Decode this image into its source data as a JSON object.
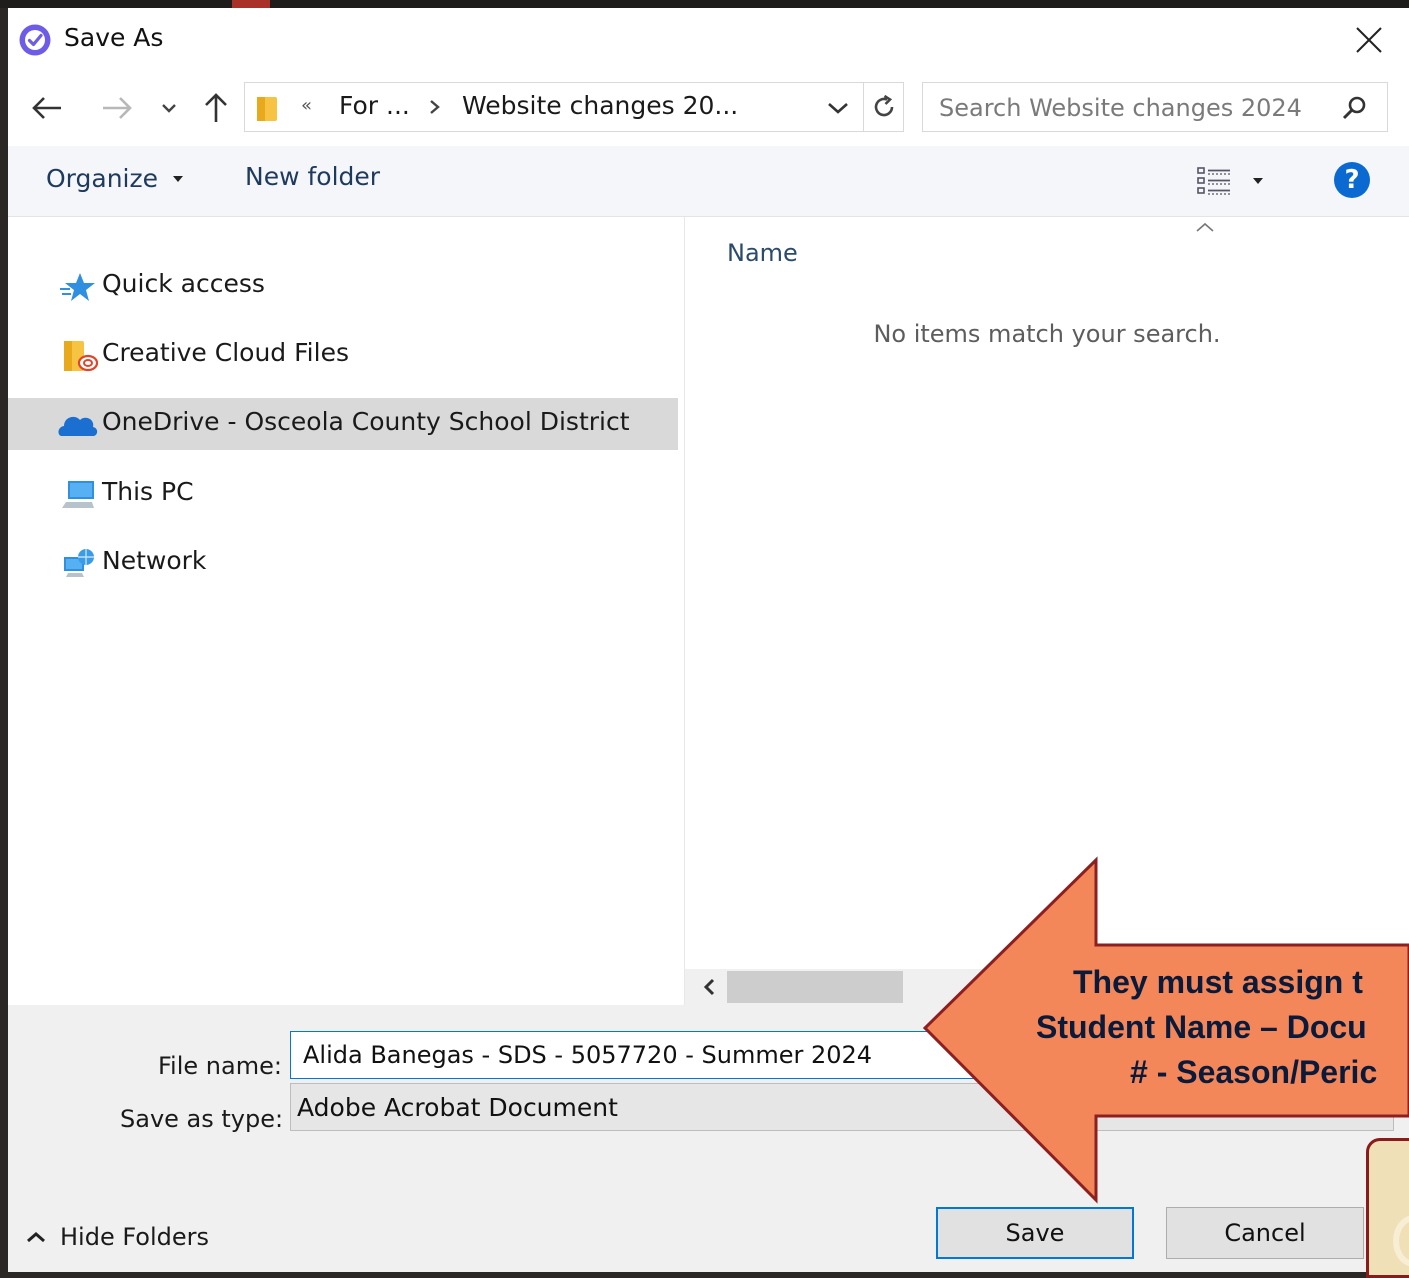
{
  "dialog": {
    "title": "Save As"
  },
  "address": {
    "overflow": "«",
    "crumbs": [
      "For ...",
      "Website changes 20..."
    ]
  },
  "search": {
    "placeholder": "Search Website changes 2024"
  },
  "toolbar": {
    "organize": "Organize",
    "new_folder": "New folder"
  },
  "nav": {
    "items": [
      {
        "label": "Quick access",
        "icon": "star-icon"
      },
      {
        "label": "Creative Cloud Files",
        "icon": "creative-cloud-folder-icon"
      },
      {
        "label": "OneDrive - Osceola County School District",
        "icon": "onedrive-cloud-icon",
        "selected": true
      },
      {
        "label": "This PC",
        "icon": "computer-icon"
      },
      {
        "label": "Network",
        "icon": "network-icon"
      }
    ]
  },
  "content": {
    "column_name": "Name",
    "empty_message": "No items match your search."
  },
  "form": {
    "filename_label": "File name:",
    "filename_value": "Alida Banegas - SDS - 5057720 - Summer 2024",
    "savetype_label": "Save as type:",
    "savetype_value": "Adobe Acrobat Document"
  },
  "buttons": {
    "hide_folders": "Hide Folders",
    "save": "Save",
    "cancel": "Cancel"
  },
  "annotation": {
    "line1": "They must assign t",
    "line2": "Student Name – Docu",
    "line3": "# - Season/Peric"
  },
  "colors": {
    "accent": "#0078d7",
    "arrow_fill": "#f4875a",
    "arrow_stroke": "#8c1f1f",
    "help": "#0b6ad1",
    "selection": "#d9d9d9"
  }
}
